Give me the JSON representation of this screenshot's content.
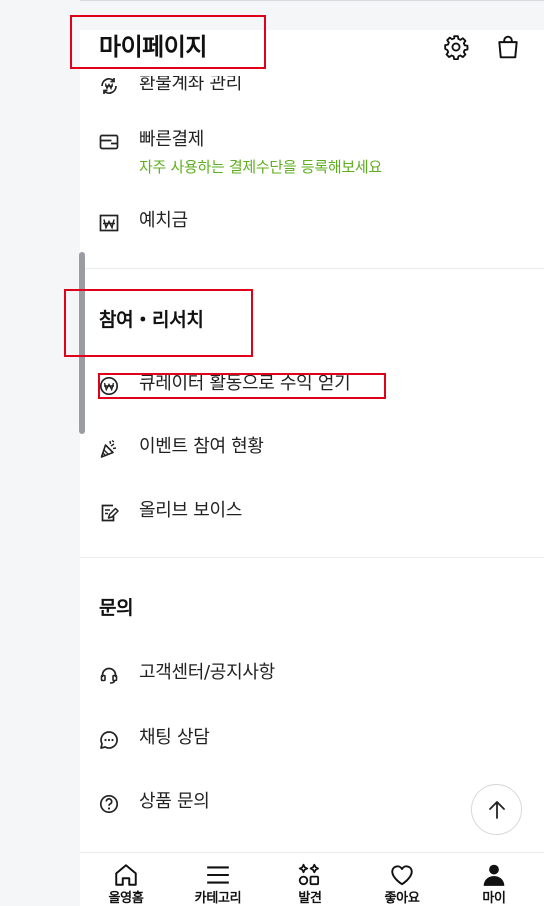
{
  "header": {
    "title": "마이페이지",
    "settings_icon": "gear-icon",
    "cart_icon": "shopping-bag-icon"
  },
  "account": {
    "items": [
      {
        "label": "환불계좌 관리",
        "icon": "refund-won-icon"
      },
      {
        "label": "빠른결제",
        "sub": "자주 사용하는 결제수단을 등록해보세요",
        "icon": "wallet-icon"
      },
      {
        "label": "예치금",
        "icon": "deposit-won-icon"
      }
    ]
  },
  "research": {
    "title": "참여・리서치",
    "items": [
      {
        "label": "큐레이터 활동으로 수익 얻기",
        "icon": "won-coin-icon"
      },
      {
        "label": "이벤트 참여 현황",
        "icon": "party-popper-icon"
      },
      {
        "label": "올리브 보이스",
        "icon": "note-pen-icon"
      }
    ]
  },
  "inquiry": {
    "title": "문의",
    "items": [
      {
        "label": "고객센터/공지사항",
        "icon": "headset-icon"
      },
      {
        "label": "채팅 상담",
        "icon": "chat-bubble-icon"
      },
      {
        "label": "상품 문의",
        "icon": "question-circle-icon"
      }
    ]
  },
  "scroll_top_icon": "arrow-up-icon",
  "tabbar": {
    "tabs": [
      {
        "label": "올영홈",
        "icon": "home-icon"
      },
      {
        "label": "카테고리",
        "icon": "menu-icon"
      },
      {
        "label": "발견",
        "icon": "discover-icon"
      },
      {
        "label": "좋아요",
        "icon": "heart-icon"
      },
      {
        "label": "마이",
        "icon": "person-icon",
        "active": true
      }
    ]
  },
  "colors": {
    "accent_green": "#5fae1f",
    "highlight_red": "#e0001a"
  }
}
